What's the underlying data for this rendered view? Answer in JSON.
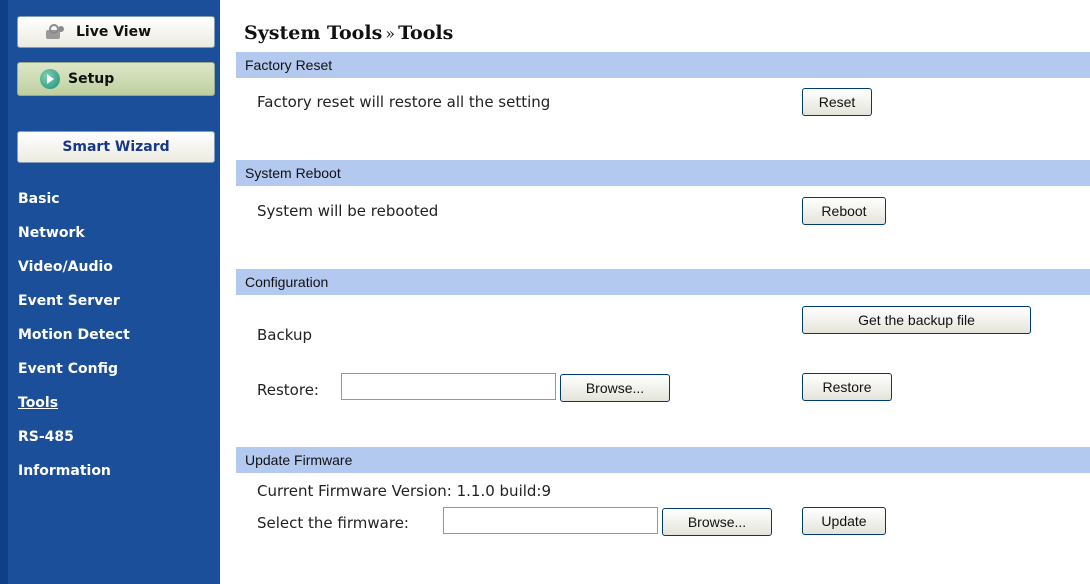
{
  "sidebar": {
    "live_view": "Live View",
    "setup": "Setup",
    "smart_wizard": "Smart Wizard",
    "menu": [
      {
        "label": "Basic"
      },
      {
        "label": "Network"
      },
      {
        "label": "Video/Audio"
      },
      {
        "label": "Event Server"
      },
      {
        "label": "Motion Detect"
      },
      {
        "label": "Event Config"
      },
      {
        "label": "Tools",
        "active": true
      },
      {
        "label": "RS-485"
      },
      {
        "label": "Information"
      }
    ]
  },
  "page": {
    "title_part1": "System Tools",
    "title_sep": "»",
    "title_part2": "Tools"
  },
  "factory_reset": {
    "header": "Factory Reset",
    "description": "Factory reset will restore all the setting",
    "button": "Reset"
  },
  "system_reboot": {
    "header": "System Reboot",
    "description": "System will be rebooted",
    "button": "Reboot"
  },
  "configuration": {
    "header": "Configuration",
    "backup_label": "Backup",
    "backup_button": "Get the backup file",
    "restore_label": "Restore:",
    "restore_value": "",
    "browse_button": "Browse...",
    "restore_button": "Restore"
  },
  "update_firmware": {
    "header": "Update Firmware",
    "version_text": "Current Firmware Version: 1.1.0 build:9",
    "select_label": "Select the firmware:",
    "select_value": "",
    "browse_button": "Browse...",
    "update_button": "Update"
  },
  "colors": {
    "sidebar_bg": "#1b4f9a",
    "section_bar": "#b4c9f0"
  },
  "icons": {
    "live_view": "camera-icon",
    "setup": "play-circle-icon"
  }
}
